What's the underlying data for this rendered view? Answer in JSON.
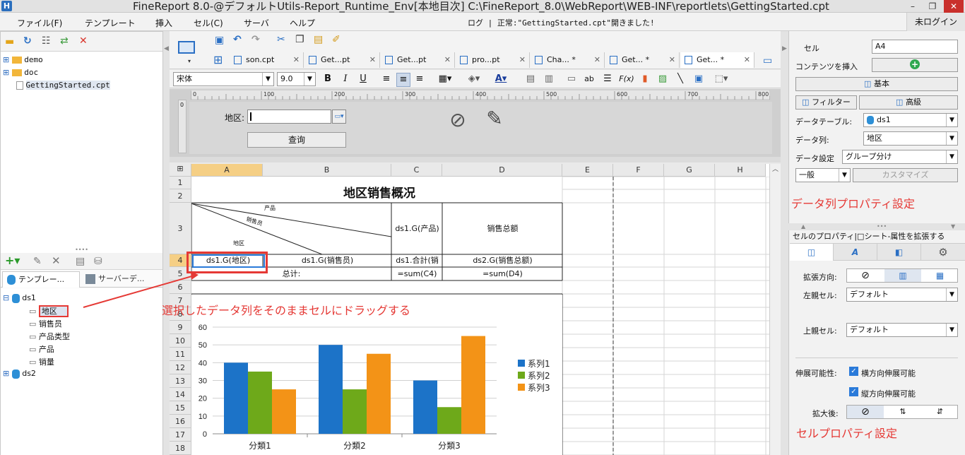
{
  "window": {
    "title": "FineReport 8.0-@デフォルトUtils-Report_Runtime_Env[本地目次]    C:\\FineReport_8.0\\WebReport\\WEB-INF\\reportlets\\GettingStarted.cpt",
    "logo": "H",
    "min": "–",
    "max": "❐",
    "close": "✕"
  },
  "menu": [
    "ファイル(F)",
    "テンプレート",
    "挿入",
    "セル(C)",
    "サーバ",
    "ヘルプ"
  ],
  "status": "ログ | 正常:\"GettingStarted.cpt\"開きました!",
  "login": "未ログイン",
  "file_tree": [
    "demo",
    "doc",
    "GettingStarted.cpt"
  ],
  "panel_tabs": [
    "テンプレー...",
    "サーバーデ..."
  ],
  "dataset_tree": {
    "ds1": "ds1",
    "fields": [
      "地区",
      "销售员",
      "产品类型",
      "产品",
      "销量"
    ],
    "ds2": "ds2"
  },
  "tabs": [
    "son.cpt",
    "Get...pt",
    "Get...pt",
    "pro...pt",
    "Cha... *",
    "Get... *",
    "Get... *"
  ],
  "font": {
    "name": "宋体",
    "size": "9.0"
  },
  "ruler": [
    "0",
    "100",
    "200",
    "300",
    "400",
    "500",
    "600",
    "700",
    "800"
  ],
  "param": {
    "label": "地区:",
    "query": "查询"
  },
  "columns": [
    "A",
    "B",
    "C",
    "D",
    "E",
    "F",
    "G",
    "H"
  ],
  "rows": [
    "1",
    "2",
    "3",
    "4",
    "5",
    "6",
    "7",
    "8",
    "9",
    "10",
    "11",
    "12",
    "13",
    "14",
    "15",
    "16",
    "17",
    "18"
  ],
  "report": {
    "title": "地区销售概况",
    "h_prod": "产品",
    "h_sales": "销售员",
    "h_region": "地区",
    "c3": "ds1.G(产品)",
    "d3": "销售总额",
    "a4": "ds1.G(地区)",
    "b4": "ds1.G(销售员)",
    "c4": "ds1.合計(销",
    "d4": "ds2.G(销售总额)",
    "total": "总计:",
    "c5": "=sum(C4)",
    "d5": "=sum(D4)"
  },
  "annotation": {
    "drag": "選択したデータ列をそのままセルにドラッグする",
    "col_prop": "データ列プロパティ設定",
    "cell_prop": "セルプロパティ設定"
  },
  "right_panel": {
    "cell_label": "セル",
    "cell_value": "A4",
    "insert_label": "コンテンツを挿入",
    "insert_icon": "+",
    "basic": "基本",
    "filter": "フィルター",
    "advanced": "高級",
    "table_label": "データテーブル:",
    "table_value": "ds1",
    "col_label": "データ列:",
    "col_value": "地区",
    "setting_label": "データ設定",
    "setting_value": "グループ分け",
    "general": "一般",
    "customize": "カスタマイズ",
    "prop_header": "セルのプロパティ|□シート-属性を拡張する",
    "expand_dir": "拡張方向:",
    "left_parent": "左親セル:",
    "left_value": "デフォルト",
    "up_parent": "上親セル:",
    "up_value": "デフォルト",
    "expandable": "伸展可能性:",
    "horiz": "横方向伸展可能",
    "vert": "縦方向伸展可能",
    "after": "拡大後:"
  },
  "chart_data": {
    "type": "bar",
    "categories": [
      "分類1",
      "分類2",
      "分類3"
    ],
    "series": [
      {
        "name": "系列1",
        "values": [
          40,
          50,
          30
        ],
        "color": "#1c73c8"
      },
      {
        "name": "系列2",
        "values": [
          35,
          25,
          15
        ],
        "color": "#6ea91a"
      },
      {
        "name": "系列3",
        "values": [
          25,
          45,
          55
        ],
        "color": "#f39317"
      }
    ],
    "yticks": [
      "0",
      "10",
      "20",
      "30",
      "40",
      "50",
      "60"
    ],
    "ylim": [
      0,
      60
    ],
    "grid": true,
    "legend": "right"
  }
}
